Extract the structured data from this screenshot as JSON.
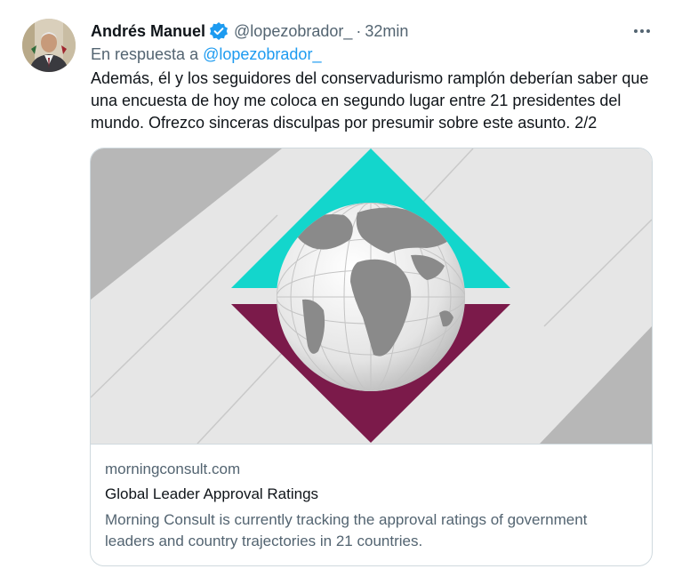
{
  "tweet": {
    "author_name": "Andrés Manuel",
    "handle": "@lopezobrador_",
    "separator": "·",
    "time": "32min",
    "reply_prefix": "En respuesta a",
    "reply_handle": "@lopezobrador_",
    "text": "Además, él y los seguidores del conservadurismo ramplón deberían saber que una encuesta de hoy me coloca en segundo lugar entre 21 presidentes del mundo. Ofrezco sinceras disculpas por presumir sobre este asunto. 2/2"
  },
  "card": {
    "domain": "morningconsult.com",
    "title": "Global Leader Approval Ratings",
    "description": "Morning Consult is currently tracking the approval ratings of government leaders and country trajectories in 21 countries."
  },
  "icons": {
    "verified": "verified-badge-icon",
    "more": "more-options-icon"
  },
  "colors": {
    "link": "#1d9bf0",
    "secondary_text": "#536471",
    "teal": "#13d6cc",
    "maroon": "#7b1a4a"
  }
}
